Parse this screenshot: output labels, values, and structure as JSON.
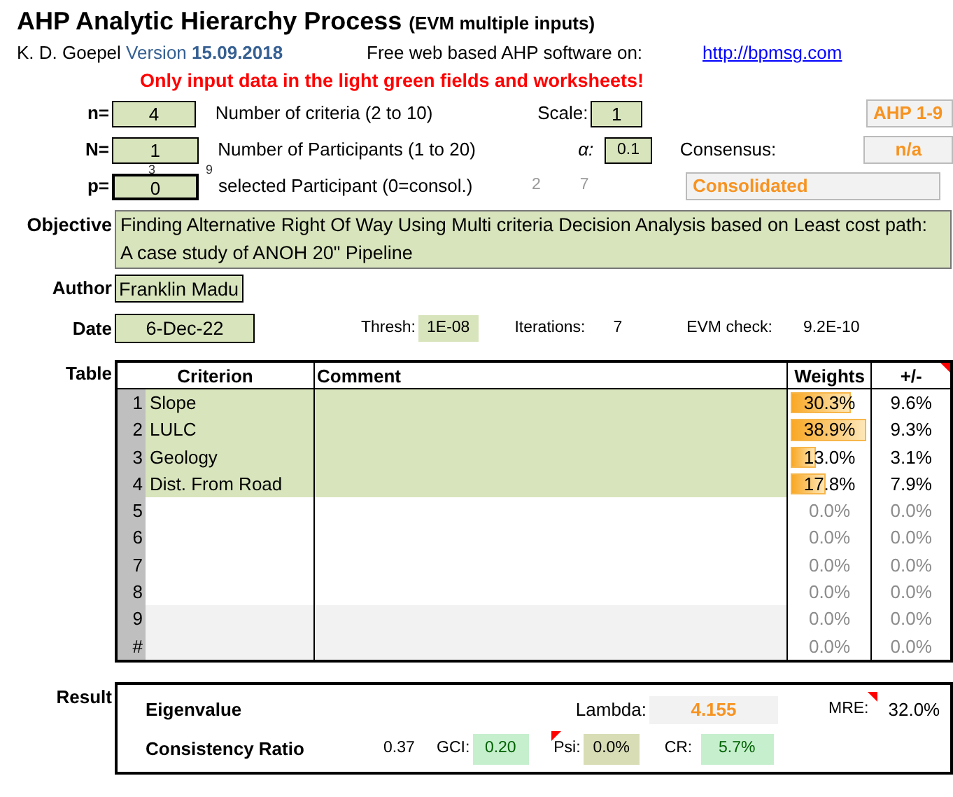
{
  "title": "AHP Analytic Hierarchy Process",
  "subtitle": "(EVM multiple inputs)",
  "author_line": {
    "author": "K. D. Goepel",
    "version_label": "Version",
    "version": "15.09.2018",
    "software_text": "Free web based AHP software on:",
    "link": "http://bpmsg.com"
  },
  "warning": "Only input data in the light green fields and worksheets!",
  "params": [
    {
      "label": "n=",
      "value": "4",
      "description": "Number of criteria (2 to 10)",
      "side_label": "Scale:",
      "side_value": "1",
      "result": "AHP 1-9"
    },
    {
      "label": "N=",
      "value": "1",
      "description": "Number of Participants (1 to 20)",
      "side_label": "α:",
      "side_value": "0.1",
      "extra_label": "Consensus:",
      "result": "n/a"
    },
    {
      "label": "p=",
      "value": "0",
      "description": "selected Participant (0=consol.)",
      "numbers": [
        "2",
        "7"
      ],
      "result": "Consolidated"
    }
  ],
  "hidden_digits": [
    "3",
    "9"
  ],
  "objective": {
    "label": "Objective",
    "value": "Finding Alternative Right Of Way Using Multi criteria Decision Analysis based on Least cost path: A case study of ANOH 20\" Pipeline"
  },
  "author": {
    "label": "Author",
    "value": "Franklin Madu"
  },
  "date": {
    "label": "Date",
    "value": "6-Dec-22",
    "thresh_label": "Thresh:",
    "thresh": "1E-08",
    "iterations_label": "Iterations:",
    "iterations": "7",
    "evm_label": "EVM check:",
    "evm": "9.2E-10"
  },
  "table": {
    "label": "Table",
    "columns": [
      "Criterion",
      "Comment",
      "Weights",
      "+/-"
    ],
    "rows": [
      {
        "index": "1",
        "criterion": "Slope",
        "kind": "input",
        "weight": "30.3%",
        "level": 0.78,
        "error": "9.6%"
      },
      {
        "index": "2",
        "criterion": "LULC",
        "kind": "input",
        "weight": "38.9%",
        "level": 1.0,
        "error": "9.3%"
      },
      {
        "index": "3",
        "criterion": "Geology",
        "kind": "input",
        "weight": "13.0%",
        "level": 0.33,
        "error": "3.1%"
      },
      {
        "index": "4",
        "criterion": "Dist. From Road",
        "kind": "input",
        "weight": "17.8%",
        "level": 0.46,
        "error": "7.9%"
      },
      {
        "index": "5",
        "kind": "unused",
        "weight": "0.0%",
        "error": "0.0%"
      },
      {
        "index": "6",
        "kind": "unused",
        "weight": "0.0%",
        "error": "0.0%"
      },
      {
        "index": "7",
        "kind": "unused",
        "weight": "0.0%",
        "error": "0.0%"
      },
      {
        "index": "8",
        "kind": "unused",
        "weight": "0.0%",
        "error": "0.0%"
      },
      {
        "index": "9",
        "kind": "locked",
        "weight": "0.0%",
        "error": "0.0%"
      },
      {
        "index": "#",
        "kind": "locked",
        "weight": "0.0%",
        "error": "0.0%"
      }
    ]
  },
  "result": {
    "label": "Result",
    "eigenvalue_label": "Eigenvalue",
    "lambda_label": "Lambda:",
    "lambda": "4.155",
    "mre_label": "MRE:",
    "mre": "32.0%",
    "cr_label": "Consistency Ratio",
    "cr_value": "0.37",
    "gci_label": "GCI:",
    "gci": "0.20",
    "psi_label": "Psi:",
    "psi": "0.0%",
    "cr_short_label": "CR:",
    "cr": "5.7%"
  }
}
